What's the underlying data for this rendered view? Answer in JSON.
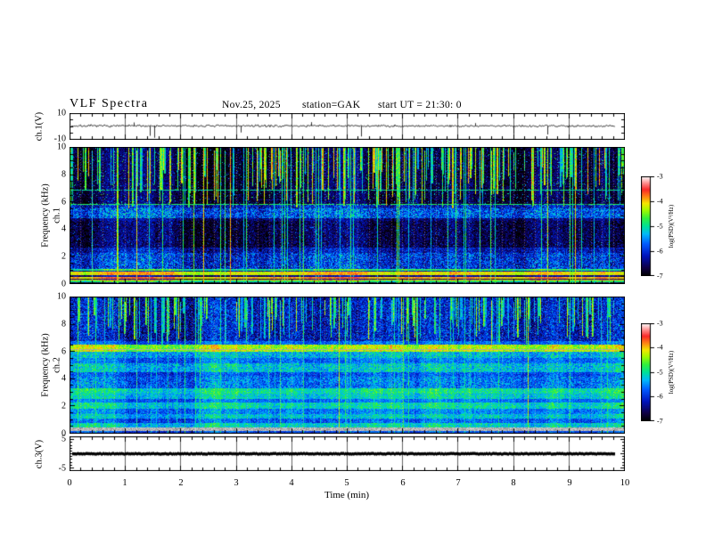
{
  "header": {
    "title": "VLF Spectra",
    "date": "Nov.25, 2025",
    "station": "station=GAK",
    "start_ut": "start UT =  21:30: 0"
  },
  "axes": {
    "x": {
      "label": "Time  (min)",
      "ticks": [
        "0",
        "1",
        "2",
        "3",
        "4",
        "5",
        "6",
        "7",
        "8",
        "9",
        "10"
      ],
      "range": [
        0,
        10
      ]
    },
    "ch1v": {
      "label": "ch.1(V)",
      "ticks": [
        "10",
        "-10"
      ],
      "range": [
        -10,
        10
      ]
    },
    "spec1": {
      "label_channel": "ch.1",
      "label_axis": "Frequency (kHz)",
      "ticks": [
        "10",
        "8",
        "6",
        "4",
        "2",
        "0"
      ],
      "range": [
        0,
        10
      ]
    },
    "spec2": {
      "label_channel": "ch.2",
      "label_axis": "Frequency (kHz)",
      "ticks": [
        "10",
        "8",
        "6",
        "4",
        "2",
        "0"
      ],
      "range": [
        0,
        10
      ]
    },
    "ch3v": {
      "label": "ch.3(V)",
      "ticks": [
        "5",
        "-5"
      ],
      "range": [
        -5,
        5
      ]
    }
  },
  "colorbars": [
    {
      "label": "log(PSD)(V²/Hz)",
      "ticks": [
        "-3",
        "-4",
        "-5",
        "-6",
        "-7"
      ],
      "min": -7,
      "max": -3
    },
    {
      "label": "log(PSD)(V²/Hz)",
      "ticks": [
        "-3",
        "-4",
        "-5",
        "-6",
        "-7"
      ],
      "min": -7,
      "max": -3
    }
  ],
  "colormap": [
    {
      "t": 0.0,
      "c": [
        0,
        0,
        0
      ]
    },
    {
      "t": 0.08,
      "c": [
        15,
        0,
        70
      ]
    },
    {
      "t": 0.2,
      "c": [
        0,
        20,
        190
      ]
    },
    {
      "t": 0.32,
      "c": [
        0,
        90,
        255
      ]
    },
    {
      "t": 0.42,
      "c": [
        0,
        185,
        250
      ]
    },
    {
      "t": 0.5,
      "c": [
        0,
        225,
        150
      ]
    },
    {
      "t": 0.58,
      "c": [
        50,
        240,
        60
      ]
    },
    {
      "t": 0.66,
      "c": [
        160,
        250,
        0
      ]
    },
    {
      "t": 0.73,
      "c": [
        245,
        230,
        0
      ]
    },
    {
      "t": 0.8,
      "c": [
        255,
        130,
        20
      ]
    },
    {
      "t": 0.87,
      "c": [
        250,
        40,
        40
      ]
    },
    {
      "t": 0.94,
      "c": [
        255,
        150,
        150
      ]
    },
    {
      "t": 1.0,
      "c": [
        255,
        255,
        255
      ]
    }
  ],
  "chart_data": [
    {
      "type": "line",
      "name": "ch1_voltage",
      "ylabel": "ch.1(V)",
      "x_range": [
        0,
        10
      ],
      "y_range": [
        -10,
        10
      ],
      "baseline": 0.4,
      "noise_amp": 0.8,
      "data_start": 0.03,
      "data_end": 9.82,
      "seed": 7,
      "down_spikes": [
        {
          "t": 1.45,
          "v": -7
        },
        {
          "t": 1.52,
          "v": -8.5
        },
        {
          "t": 3.08,
          "v": -4.5
        },
        {
          "t": 5.25,
          "v": -7.5
        },
        {
          "t": 8.0,
          "v": -5.5
        },
        {
          "t": 8.6,
          "v": -6
        }
      ],
      "up_spikes": [
        {
          "t": 1.15,
          "v": 3
        },
        {
          "t": 4.35,
          "v": 3.2
        },
        {
          "t": 7.3,
          "v": 2.5
        }
      ]
    },
    {
      "type": "heatmap",
      "name": "ch1_spectrogram",
      "ylabel": "ch.1 Frequency (kHz)",
      "x_range": [
        0,
        10
      ],
      "y_range": [
        0,
        10
      ],
      "z_range": [
        -7,
        -3
      ],
      "seed": 21,
      "bands": [
        {
          "lo": 5.75,
          "hi": 10.0,
          "base": 0.08,
          "noise": 0.09,
          "spark_p": 0.05,
          "spark_amp": 0.5
        },
        {
          "lo": 5.5,
          "hi": 5.75,
          "base": 0.22,
          "noise": 0.15
        },
        {
          "lo": 4.8,
          "hi": 5.5,
          "base": 0.3,
          "noise": 0.16,
          "spark_p": 0.08,
          "spark_amp": 0.25
        },
        {
          "lo": 4.6,
          "hi": 4.8,
          "base": 0.14,
          "noise": 0.1
        },
        {
          "lo": 2.65,
          "hi": 4.6,
          "base": 0.09,
          "noise": 0.1,
          "spark_p": 0.05,
          "spark_amp": 0.3
        },
        {
          "lo": 2.3,
          "hi": 2.65,
          "base": 0.2,
          "noise": 0.13
        },
        {
          "lo": 1.12,
          "hi": 2.3,
          "base": 0.25,
          "noise": 0.15,
          "spark_p": 0.07,
          "spark_amp": 0.3
        },
        {
          "lo": 1.0,
          "hi": 1.12,
          "base": 0.55,
          "noise": 0.1
        },
        {
          "lo": 0.92,
          "hi": 1.0,
          "base": 0.2,
          "noise": 0.08
        },
        {
          "lo": 0.63,
          "hi": 0.92,
          "base": 0.73,
          "noise": 0.07
        },
        {
          "lo": 0.52,
          "hi": 0.63,
          "base": 0.15,
          "noise": 0.06
        },
        {
          "lo": 0.42,
          "hi": 0.52,
          "base": 0.78,
          "noise": 0.05
        },
        {
          "lo": 0.34,
          "hi": 0.42,
          "base": 0.12,
          "noise": 0.05
        },
        {
          "lo": 0.26,
          "hi": 0.34,
          "base": 0.76,
          "noise": 0.06
        },
        {
          "lo": 0.14,
          "hi": 0.26,
          "base": 0.55,
          "noise": 0.08
        },
        {
          "lo": 0.0,
          "hi": 0.14,
          "base": 0.1,
          "noise": 0.06
        }
      ],
      "lines": [
        {
          "f": 6.9,
          "t": 0.5
        },
        {
          "f": 5.85,
          "t": 0.55
        }
      ],
      "streaks": {
        "count": 200,
        "depth_min": 5.5,
        "depth_max": 8.6,
        "t_min": 0.42,
        "t_max": 0.78,
        "full_positions": [
          1.2,
          2.72,
          4.2,
          5.05,
          6.95,
          9.0
        ],
        "full_t": 0.55,
        "full_count": 40
      }
    },
    {
      "type": "heatmap",
      "name": "ch2_spectrogram",
      "ylabel": "ch.2 Frequency (kHz)",
      "x_range": [
        0,
        10
      ],
      "y_range": [
        0,
        10
      ],
      "z_range": [
        -7,
        -3
      ],
      "seed": 33,
      "bands": [
        {
          "lo": 6.75,
          "hi": 10.0,
          "base": 0.2,
          "noise": 0.13,
          "spark_p": 0.08,
          "spark_amp": 0.28
        },
        {
          "lo": 6.5,
          "hi": 6.75,
          "base": 0.32,
          "noise": 0.1
        },
        {
          "lo": 6.0,
          "hi": 6.5,
          "base": 0.66,
          "noise": 0.09,
          "spark_p": 0.12,
          "spark_amp": 0.15
        },
        {
          "lo": 5.55,
          "hi": 6.0,
          "base": 0.42,
          "noise": 0.12
        },
        {
          "lo": 5.1,
          "hi": 5.55,
          "base": 0.34,
          "noise": 0.1
        },
        {
          "lo": 4.45,
          "hi": 5.1,
          "base": 0.44,
          "noise": 0.12
        },
        {
          "lo": 4.15,
          "hi": 4.45,
          "base": 0.3,
          "noise": 0.1
        },
        {
          "lo": 3.3,
          "hi": 4.15,
          "base": 0.34,
          "noise": 0.12,
          "spark_p": 0.06,
          "spark_amp": 0.2
        },
        {
          "lo": 2.9,
          "hi": 3.3,
          "base": 0.5,
          "noise": 0.1
        },
        {
          "lo": 2.55,
          "hi": 2.9,
          "base": 0.46,
          "noise": 0.1
        },
        {
          "lo": 2.25,
          "hi": 2.55,
          "base": 0.34,
          "noise": 0.08
        },
        {
          "lo": 1.8,
          "hi": 2.25,
          "base": 0.48,
          "noise": 0.1
        },
        {
          "lo": 1.45,
          "hi": 1.8,
          "base": 0.36,
          "noise": 0.1
        },
        {
          "lo": 1.1,
          "hi": 1.45,
          "base": 0.44,
          "noise": 0.1
        },
        {
          "lo": 0.8,
          "hi": 1.1,
          "base": 0.32,
          "noise": 0.1
        },
        {
          "lo": 0.45,
          "hi": 0.8,
          "base": 0.46,
          "noise": 0.1
        },
        {
          "lo": 0.18,
          "hi": 0.45,
          "grey": true
        },
        {
          "lo": 0.08,
          "hi": 0.18,
          "base": 0.3,
          "noise": 0.08
        },
        {
          "lo": 0.03,
          "hi": 0.08,
          "base": 0.8,
          "noise": 0.04
        },
        {
          "lo": 0.0,
          "hi": 0.03,
          "base": 0.1,
          "noise": 0.04
        }
      ],
      "lines": [
        {
          "f": 6.2,
          "grey": true
        }
      ],
      "streaks": {
        "count": 170,
        "depth_min": 6.5,
        "depth_max": 8.8,
        "t_min": 0.38,
        "t_max": 0.68,
        "full_positions": [
          1.2,
          2.72,
          4.2,
          5.05,
          9.0
        ],
        "full_t": 0.5,
        "full_count": 30
      }
    },
    {
      "type": "line",
      "name": "ch3_voltage",
      "ylabel": "ch.3(V)",
      "x_range": [
        0,
        10
      ],
      "y_range": [
        -5,
        5
      ],
      "baseline": 0,
      "thickness": 3,
      "data_start": 0.05,
      "data_end": 9.8,
      "seed": 11
    }
  ]
}
